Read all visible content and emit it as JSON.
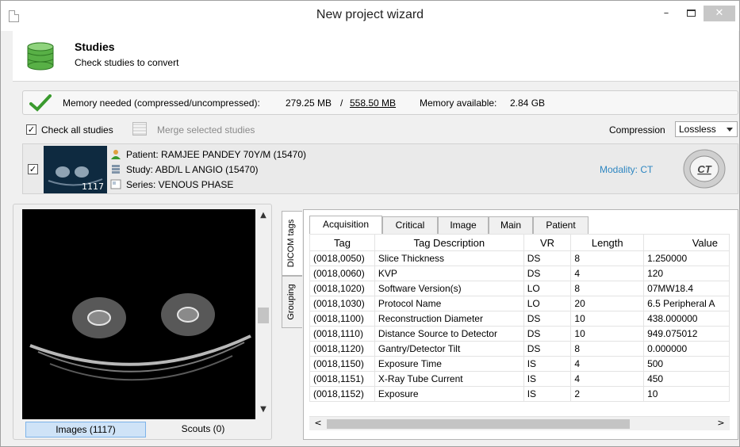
{
  "window": {
    "title": "New project wizard",
    "minimize": "–",
    "close": "✕"
  },
  "header": {
    "title": "Studies",
    "subtitle": "Check studies to convert"
  },
  "memory": {
    "label": "Memory needed (compressed/uncompressed):",
    "compressed": "279.25 MB",
    "separator": "/",
    "uncompressed": "558.50 MB",
    "available_label": "Memory available:",
    "available_value": "2.84 GB"
  },
  "toolbar": {
    "check_all_label": "Check all studies",
    "check_all_checked": true,
    "merge_label": "Merge selected studies",
    "compression_label": "Compression",
    "compression_value": "Lossless"
  },
  "study": {
    "checked": true,
    "image_count": "1117",
    "patient": "Patient: RAMJEE PANDEY 70Y/M (15470)",
    "study": "Study: ABD/L L ANGIO (15470)",
    "series": "Series: VENOUS PHASE",
    "modality": "Modality: CT",
    "modality_badge": "CT"
  },
  "viewer": {
    "tabs": [
      "Images (1117)",
      "Scouts (0)"
    ],
    "active_tab": "Images (1117)"
  },
  "side_tabs": [
    "DICOM tags",
    "Grouping"
  ],
  "tag_tabs": [
    "Acquisition",
    "Critical",
    "Image",
    "Main",
    "Patient"
  ],
  "active_tag_tab": "Acquisition",
  "table": {
    "columns": [
      "Tag",
      "Tag Description",
      "VR",
      "Length",
      "Value"
    ],
    "rows": [
      [
        "(0018,0050)",
        "Slice Thickness",
        "DS",
        "8",
        "1.250000"
      ],
      [
        "(0018,0060)",
        "KVP",
        "DS",
        "4",
        "120"
      ],
      [
        "(0018,1020)",
        "Software Version(s)",
        "LO",
        "8",
        "07MW18.4"
      ],
      [
        "(0018,1030)",
        "Protocol Name",
        "LO",
        "20",
        "6.5 Peripheral A"
      ],
      [
        "(0018,1100)",
        "Reconstruction Diameter",
        "DS",
        "10",
        "438.000000"
      ],
      [
        "(0018,1110)",
        "Distance Source to Detector",
        "DS",
        "10",
        "949.075012"
      ],
      [
        "(0018,1120)",
        "Gantry/Detector Tilt",
        "DS",
        "8",
        "0.000000"
      ],
      [
        "(0018,1150)",
        "Exposure Time",
        "IS",
        "4",
        "500"
      ],
      [
        "(0018,1151)",
        "X-Ray Tube Current",
        "IS",
        "4",
        "450"
      ],
      [
        "(0018,1152)",
        "Exposure",
        "IS",
        "2",
        "10"
      ]
    ]
  },
  "colors": {
    "accent": "#2e86c1",
    "active_tab_bg": "#cfe3f7",
    "check_green": "#3a9a2e"
  }
}
